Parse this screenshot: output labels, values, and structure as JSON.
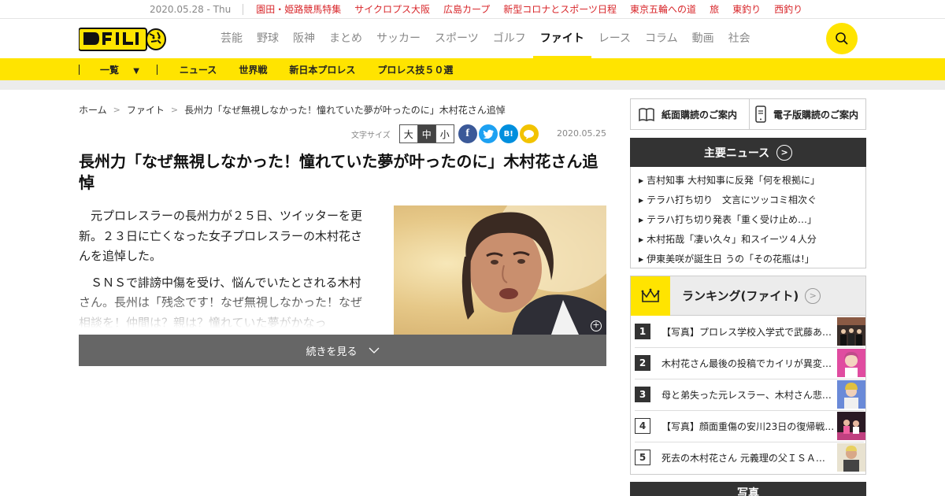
{
  "topbar": {
    "date": "2020.05.28 - Thu",
    "links": [
      "園田・姫路競馬特集",
      "サイクロプス大阪",
      "広島カープ",
      "新型コロナとスポーツ日程",
      "東京五輪への道",
      "旅",
      "東釣り",
      "西釣り"
    ]
  },
  "header": {
    "logo_alt": "デイリー",
    "nav": [
      "芸能",
      "野球",
      "阪神",
      "まとめ",
      "サッカー",
      "スポーツ",
      "ゴルフ",
      "ファイト",
      "レース",
      "コラム",
      "動画",
      "社会"
    ],
    "active_nav": "ファイト",
    "search_icon": "search-icon"
  },
  "subnav": {
    "list_label": "一覧",
    "items": [
      "ニュース",
      "世界戦",
      "新日本プロレス",
      "プロレス技５０選"
    ]
  },
  "breadcrumb": [
    "ホーム",
    "ファイト",
    "長州力「なぜ無視しなかった！憧れていた夢が叶ったのに」木村花さん追悼"
  ],
  "tools": {
    "font_size_label": "文字サイズ",
    "font_sizes": [
      "大",
      "中",
      "小"
    ],
    "selected_font_size": "中",
    "share_icons": [
      "facebook-icon",
      "twitter-icon",
      "hatena-icon",
      "line-icon"
    ],
    "hatena_label": "B!"
  },
  "article": {
    "date": "2020.05.25",
    "title": "長州力「なぜ無視しなかった！憧れていた夢が叶ったのに」木村花さん追悼",
    "paragraphs": [
      "元プロレスラーの長州力が２５日、ツイッターを更新。２３日に亡くなった女子プロレスラーの木村花さんを追悼した。",
      "ＳＮＳで誹謗中傷を受け、悩んでいたとされる木村さん。長州は「残念です！なぜ無視しなかった！なぜ相談を！仲間は？親は？憧れていた夢がかなっ"
    ],
    "more_label": "続きを見る"
  },
  "sidebar": {
    "subscribe_paper": "紙面購読のご案内",
    "subscribe_digital": "電子版購読のご案内",
    "news_title": "主要ニュース",
    "news": [
      "吉村知事 大村知事に反発「何を根拠に」",
      "テラハ打ち切り　文言にツッコミ相次ぐ",
      "テラハ打ち切り発表「重く受け止め…」",
      "木村拓哉「凄い久々」和スイーツ４人分",
      "伊東美咲が誕生日 うの「その花瓶は!」"
    ],
    "ranking_title": "ランキング(ファイト)",
    "ranking": [
      {
        "rank": "1",
        "text": "【写真】プロレス学校入学式で武藤あ…"
      },
      {
        "rank": "2",
        "text": "木村花さん最後の投稿でカイリが異変…"
      },
      {
        "rank": "3",
        "text": "母と弟失った元レスラー、木村さん悲…"
      },
      {
        "rank": "4",
        "text": "【写真】顔面重傷の安川23日の復帰戦…"
      },
      {
        "rank": "5",
        "text": "死去の木村花さん 元義理の父ＩＳＡ…"
      }
    ],
    "photo_title": "写真"
  },
  "colors": {
    "accent_yellow": "#ffe400",
    "link_red": "#d8262a",
    "dark": "#333333"
  }
}
